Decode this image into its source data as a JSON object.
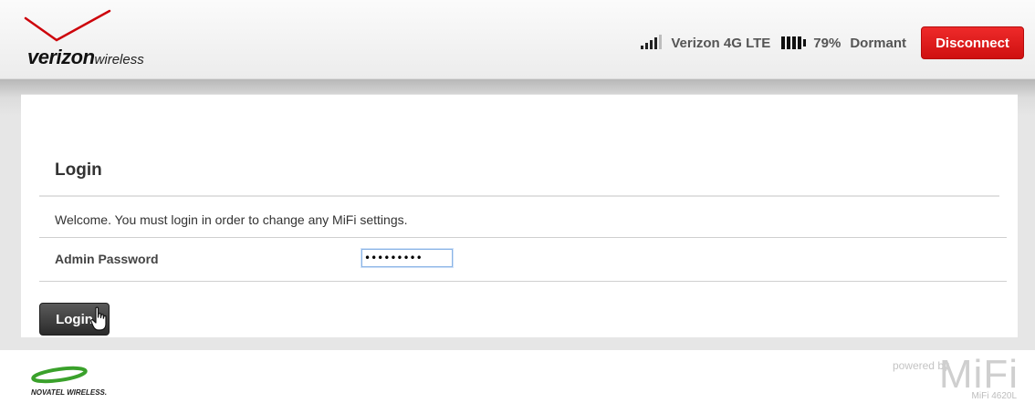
{
  "brand": {
    "word": "verizon",
    "sub": "wireless",
    "check_color": "#cd040b"
  },
  "status": {
    "signal_bars_filled": 4,
    "signal_bars_total": 5,
    "carrier": "Verizon 4G LTE",
    "battery_percent": "79%",
    "state": "Dormant",
    "disconnect_label": "Disconnect"
  },
  "login": {
    "title": "Login",
    "welcome": "Welcome. You must login in order to change any MiFi settings.",
    "password_label": "Admin Password",
    "password_value": "•••••••••",
    "button_label": "Login"
  },
  "footer": {
    "partner": "NOVATEL WIRELESS.",
    "powered_by": "powered by",
    "product": "MiFi",
    "model": "MiFi 4620L"
  },
  "colors": {
    "disconnect": "#e21b1b",
    "login_button": "#3a3a3a"
  }
}
